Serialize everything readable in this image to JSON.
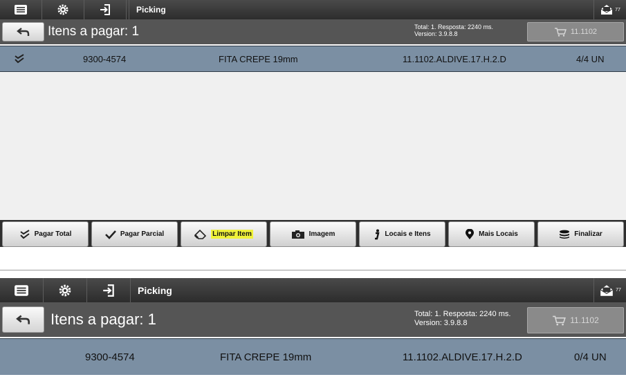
{
  "screen1": {
    "toolbar": {
      "title": "Picking",
      "mail_count": "77"
    },
    "header": {
      "title": "Itens a pagar: 1",
      "info_line1": "Total: 1. Resposta: 2240 ms.",
      "info_line2": "Version: 3.9.8.8",
      "cart_label": "11.1102"
    },
    "item": {
      "code": "9300-4574",
      "description": "FITA CREPE 19mm",
      "location": "11.1102.ALDIVE.17.H.2.D",
      "quantity": "4/4 UN"
    },
    "actions": [
      {
        "label": "Pagar Total",
        "icon": "double-check-icon"
      },
      {
        "label": "Pagar Parcial",
        "icon": "check-icon"
      },
      {
        "label": "Limpar Item",
        "icon": "eraser-icon"
      },
      {
        "label": "Imagem",
        "icon": "camera-icon"
      },
      {
        "label": "Locais e Itens",
        "icon": "info-icon"
      },
      {
        "label": "Mais Locais",
        "icon": "location-pin-icon"
      },
      {
        "label": "Finalizar",
        "icon": "database-icon"
      }
    ]
  },
  "screen2": {
    "toolbar": {
      "title": "Picking",
      "mail_count": "77"
    },
    "header": {
      "title": "Itens a pagar: 1",
      "info_line1": "Total: 1. Resposta: 2240 ms.",
      "info_line2": "Version: 3.9.8.8",
      "cart_label": "11.1102"
    },
    "item": {
      "code": "9300-4574",
      "description": "FITA CREPE 19mm",
      "location": "11.1102.ALDIVE.17.H.2.D",
      "quantity": "0/4 UN"
    }
  },
  "colors": {
    "row_background": "#7b8fa3",
    "highlight": "#f0f23a",
    "toolbar": "#3a3a3a",
    "subbar": "#555555"
  }
}
